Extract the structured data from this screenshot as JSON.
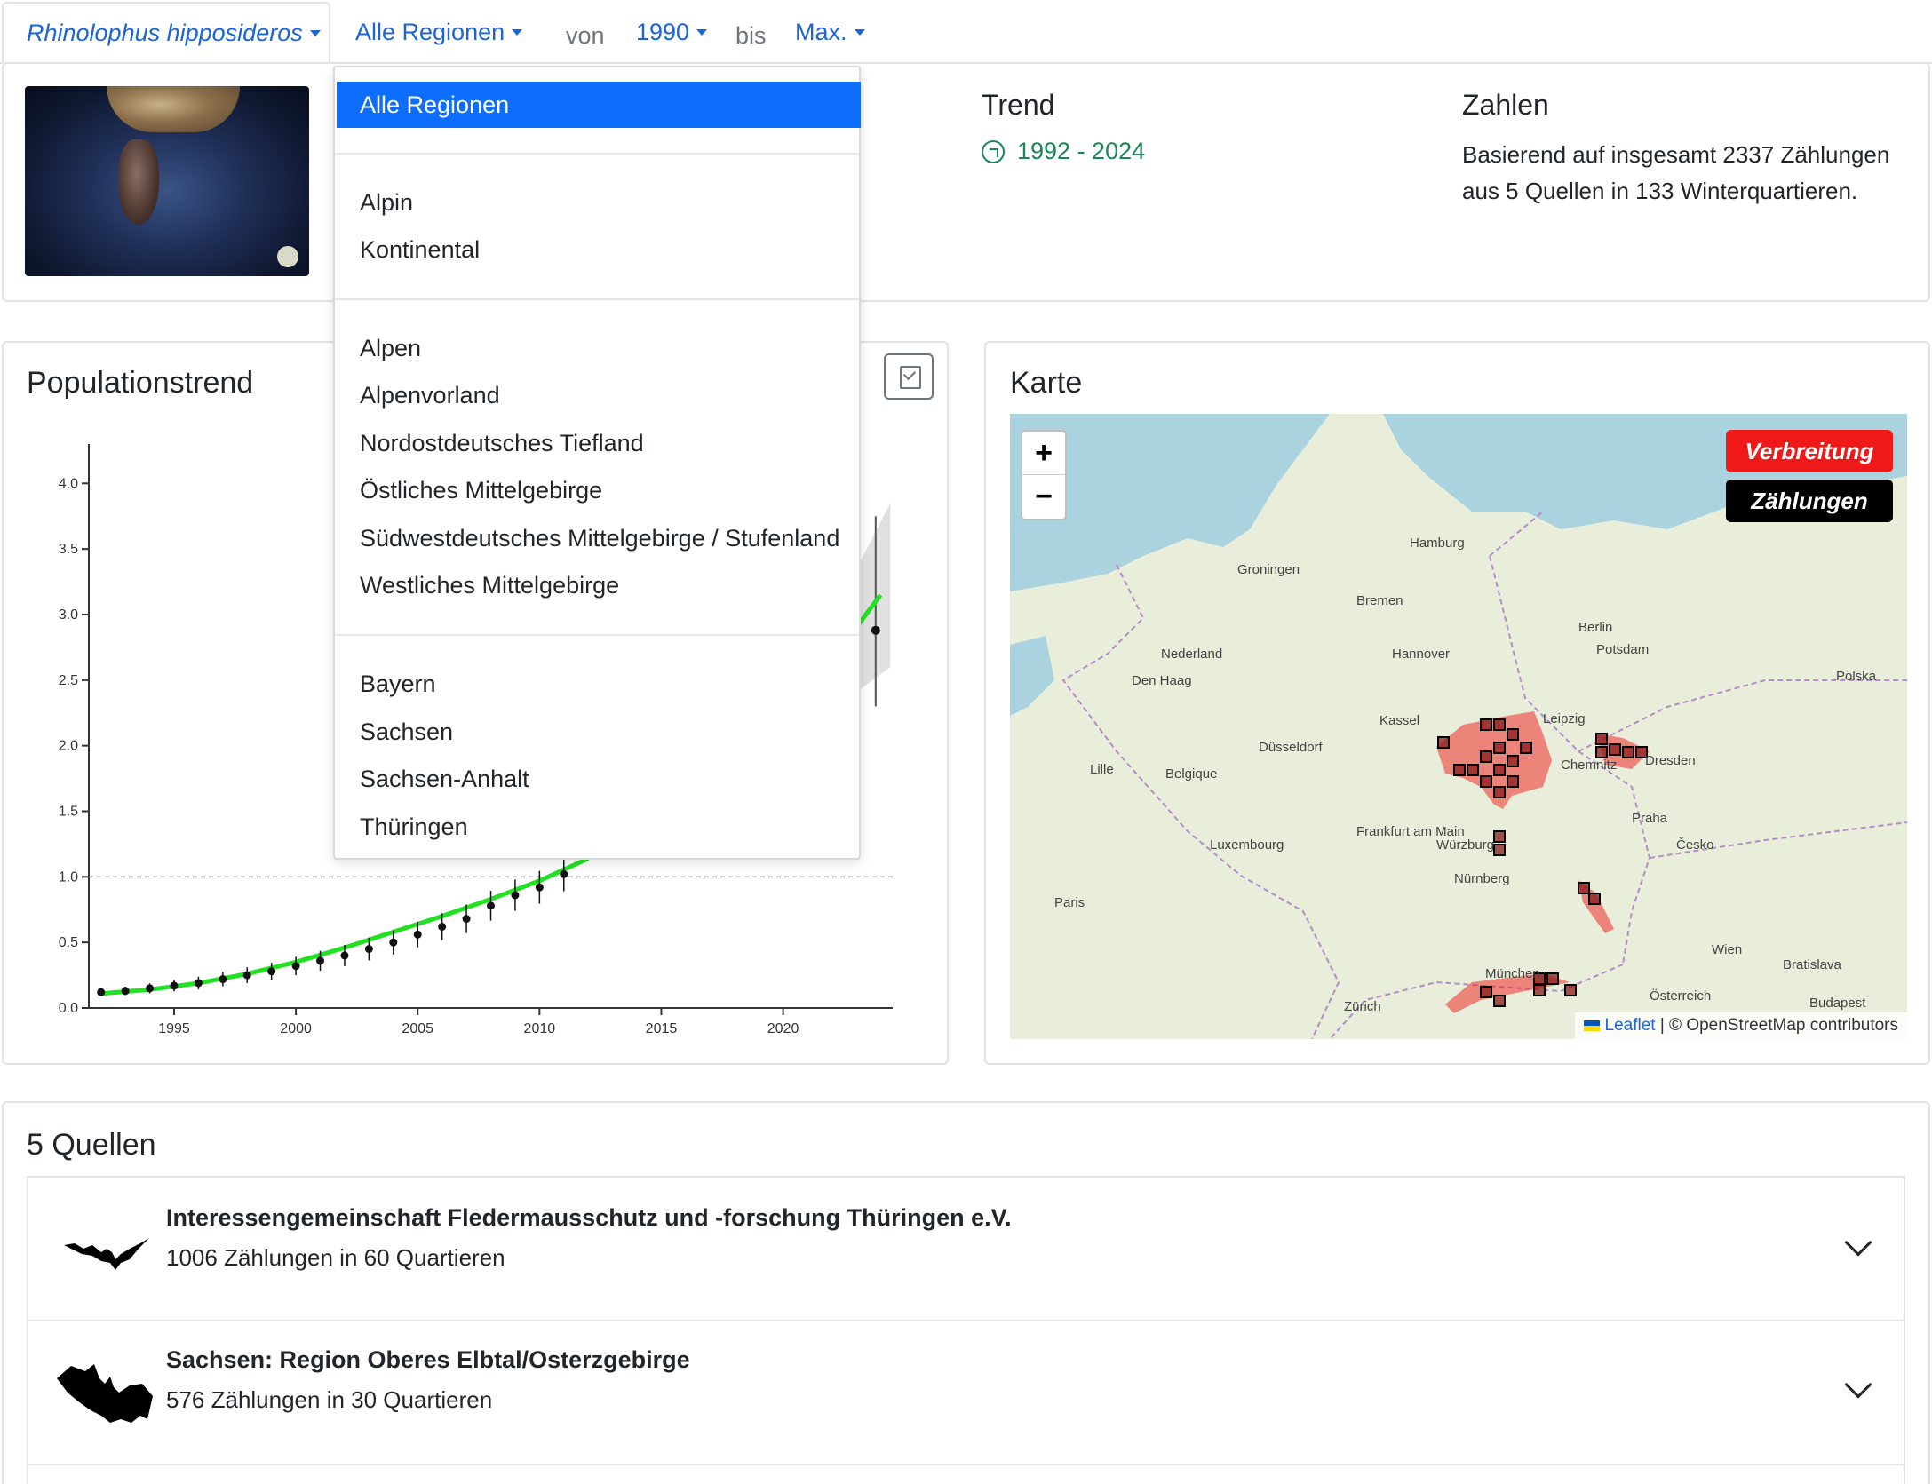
{
  "nav": {
    "species": "Rhinolophus hipposideros",
    "region": "Alle Regionen",
    "from_label": "von",
    "from_value": "1990",
    "to_label": "bis",
    "to_value": "Max."
  },
  "summary": {
    "trend_title": "Trend",
    "trend_range": "1992 - 2024",
    "numbers_title": "Zahlen",
    "numbers_text": "Basierend auf insgesamt 2337 Zählungen aus 5 Quellen in 133 Winterquartieren."
  },
  "population": {
    "title": "Populationstrend"
  },
  "chart_data": {
    "type": "line",
    "xlim": [
      1991.5,
      2024.5
    ],
    "ylim": [
      0,
      4.3
    ],
    "x_ticks": [
      1995,
      2000,
      2005,
      2010,
      2015,
      2020
    ],
    "y_ticks": [
      "0.0",
      "0.5",
      "1.0",
      "1.5",
      "2.0",
      "2.5",
      "3.0",
      "3.5",
      "4.0"
    ],
    "reference_line": 1.0,
    "colors": {
      "trend": "#22e122",
      "points": "#111111",
      "band": "#cccccc"
    },
    "trend": {
      "x": [
        1992,
        1994,
        1996,
        1998,
        2000,
        2002,
        2004,
        2006,
        2008,
        2010,
        2012
      ],
      "y": [
        0.11,
        0.14,
        0.19,
        0.26,
        0.35,
        0.46,
        0.58,
        0.7,
        0.83,
        0.97,
        1.14
      ]
    },
    "points": {
      "x": [
        1992,
        1993,
        1994,
        1995,
        1996,
        1997,
        1998,
        1999,
        2000,
        2001,
        2002,
        2003,
        2004,
        2005,
        2006,
        2007,
        2008,
        2009,
        2010,
        2011
      ],
      "y": [
        0.12,
        0.13,
        0.15,
        0.17,
        0.19,
        0.22,
        0.25,
        0.28,
        0.32,
        0.36,
        0.4,
        0.45,
        0.5,
        0.56,
        0.62,
        0.68,
        0.78,
        0.86,
        0.92,
        1.02
      ]
    },
    "late_trend": {
      "x": [
        2022.8,
        2024
      ],
      "y": [
        2.85,
        3.15
      ]
    },
    "late_points": {
      "x": [
        2022.8,
        2023.8
      ],
      "y": [
        2.83,
        2.88
      ]
    }
  },
  "map": {
    "title": "Karte",
    "zoom_in": "+",
    "zoom_out": "−",
    "layer_distribution": "Verbreitung",
    "layer_counts": "Zählungen",
    "attribution_leaflet": "Leaflet",
    "attribution_osm": "| © OpenStreetMap contributors",
    "colors": {
      "distribution": "#f01919",
      "counts": "#000000",
      "water": "#aad3df",
      "land": "#e8eed9"
    },
    "labels": [
      "Hamburg",
      "Bremen",
      "Berlin",
      "Hannover",
      "Groningen",
      "Den Haag",
      "Düsseldorf",
      "Kassel",
      "Leipzig",
      "Chemnitz",
      "Praha",
      "Frankfurt am Main",
      "Nürnberg",
      "München",
      "Wien",
      "Paris",
      "Zürich",
      "Budapest",
      "Polska",
      "Česko",
      "Belgique",
      "Nederland",
      "Österreich",
      "Bratislava",
      "Luxembourg",
      "Potsdam",
      "Würzburg",
      "Lille",
      "Dresden"
    ]
  },
  "dropdown": {
    "active": "Alle Regionen",
    "group1": [
      "Alpin",
      "Kontinental"
    ],
    "group2": [
      "Alpen",
      "Alpenvorland",
      "Nordostdeutsches Tiefland",
      "Östliches Mittelgebirge",
      "Südwestdeutsches Mittelgebirge / Stufenland",
      "Westliches Mittelgebirge"
    ],
    "group3": [
      "Bayern",
      "Sachsen",
      "Sachsen-Anhalt",
      "Thüringen"
    ]
  },
  "sources": {
    "title": "5 Quellen",
    "items": [
      {
        "name": "Interessengemeinschaft Fledermausschutz und -forschung Thüringen e.V.",
        "detail": "1006 Zählungen in 60 Quartieren"
      },
      {
        "name": "Sachsen: Region Oberes Elbtal/Osterzgebirge",
        "detail": "576 Zählungen in 30 Quartieren"
      }
    ]
  }
}
